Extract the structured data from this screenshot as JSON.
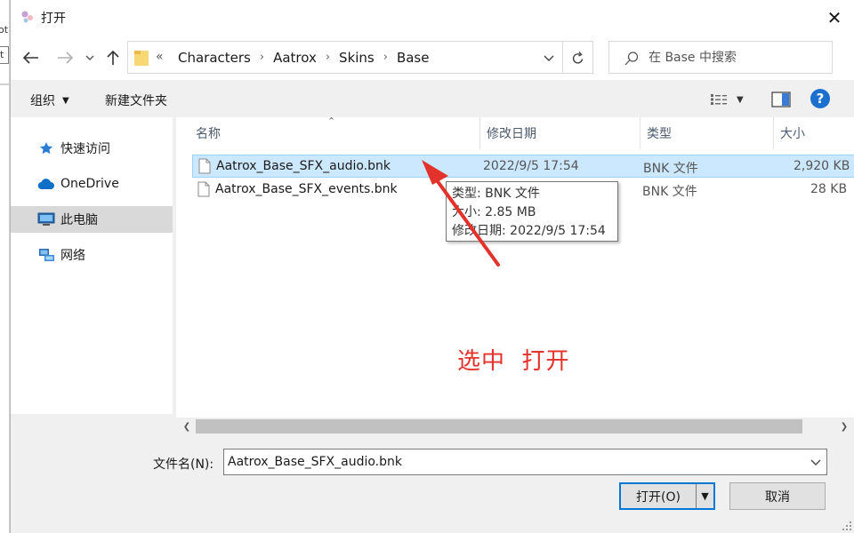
{
  "background": {
    "frag1": "ot",
    "frag2": "t"
  },
  "window": {
    "title": "打开",
    "close_glyph": "✕"
  },
  "address": {
    "overflow": "«",
    "crumbs": [
      "Characters",
      "Aatrox",
      "Skins",
      "Base"
    ],
    "separator": "›"
  },
  "search": {
    "placeholder": "在 Base 中搜索"
  },
  "toolbar": {
    "organize_label": "组织",
    "new_folder_label": "新建文件夹"
  },
  "nav_pane": {
    "items": [
      {
        "label": "快速访问",
        "icon": "star-icon"
      },
      {
        "label": "OneDrive",
        "icon": "cloud-icon"
      },
      {
        "label": "此电脑",
        "icon": "computer-icon",
        "selected": true
      },
      {
        "label": "网络",
        "icon": "network-icon"
      }
    ]
  },
  "columns": {
    "name": "名称",
    "date": "修改日期",
    "type": "类型",
    "size": "大小"
  },
  "files": [
    {
      "name": "Aatrox_Base_SFX_audio.bnk",
      "date": "2022/9/5 17:54",
      "type": "BNK 文件",
      "size": "2,920 KB",
      "selected": true
    },
    {
      "name": "Aatrox_Base_SFX_events.bnk",
      "date": "",
      "type": "BNK 文件",
      "size": "28 KB",
      "selected": false
    }
  ],
  "tooltip": {
    "type_line": "类型: BNK 文件",
    "size_line": "大小: 2.85 MB",
    "date_line": "修改日期: 2022/9/5 17:54"
  },
  "filename": {
    "label": "文件名(N):",
    "value": "Aatrox_Base_SFX_audio.bnk"
  },
  "buttons": {
    "open": "打开(O)",
    "cancel": "取消"
  },
  "annotation": {
    "text": "选中  打开",
    "color": "#e3322b"
  },
  "colors": {
    "accent": "#0078d7",
    "selection": "#cce8ff",
    "help": "#1b6fcf"
  }
}
